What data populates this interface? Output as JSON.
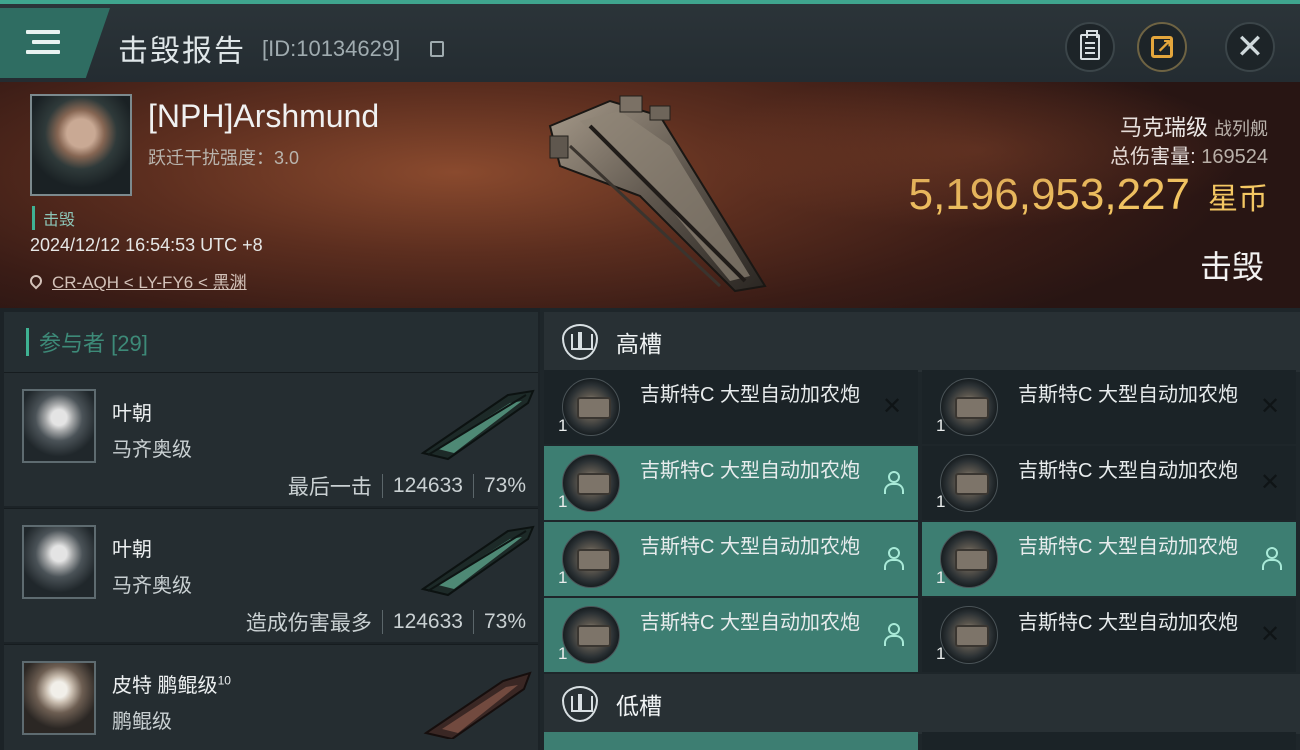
{
  "header": {
    "title": "击毁报告",
    "report_id": "[ID:10134629]"
  },
  "victim": {
    "name": "[NPH]Arshmund",
    "jam_strength": "跃迁干扰强度：3.0",
    "status": "击毁",
    "time": "2024/12/12 16:54:53 UTC +8",
    "location": "CR-AQH < LY-FY6 < 黑渊",
    "ship_name": "马克瑞级",
    "ship_type": "战列舰",
    "total_damage_label": "总伤害量:",
    "total_damage_value": "169524",
    "isk_value": "5,196,953,227",
    "isk_unit": "星币",
    "result": "击毁"
  },
  "participants": {
    "header": "参与者 [29]",
    "items": [
      {
        "name": "叶朝",
        "ship": "马齐奥级",
        "role": "最后一击",
        "damage": "124633",
        "percent": "73%"
      },
      {
        "name": "叶朝",
        "ship": "马齐奥级",
        "role": "造成伤害最多",
        "damage": "124633",
        "percent": "73%"
      },
      {
        "name": "皮特 鹏鲲级",
        "name_sup": "10",
        "ship": "鹏鲲级"
      }
    ]
  },
  "fitting": {
    "high_slot_label": "高槽",
    "low_slot_label": "低槽",
    "modules": [
      {
        "qty": "1",
        "name": "吉斯特C 大型自动加农炮",
        "state": "destroyed"
      },
      {
        "qty": "1",
        "name": "吉斯特C 大型自动加农炮",
        "state": "destroyed"
      },
      {
        "qty": "1",
        "name": "吉斯特C 大型自动加农炮",
        "state": "dropped"
      },
      {
        "qty": "1",
        "name": "吉斯特C 大型自动加农炮",
        "state": "destroyed"
      },
      {
        "qty": "1",
        "name": "吉斯特C 大型自动加农炮",
        "state": "dropped"
      },
      {
        "qty": "1",
        "name": "吉斯特C 大型自动加农炮",
        "state": "dropped"
      },
      {
        "qty": "1",
        "name": "吉斯特C 大型自动加农炮",
        "state": "dropped"
      },
      {
        "qty": "1",
        "name": "吉斯特C 大型自动加农炮",
        "state": "destroyed"
      }
    ]
  },
  "colors": {
    "accent": "#3fb293",
    "isk": "#f4c763",
    "active_module": "#3d7e72"
  }
}
